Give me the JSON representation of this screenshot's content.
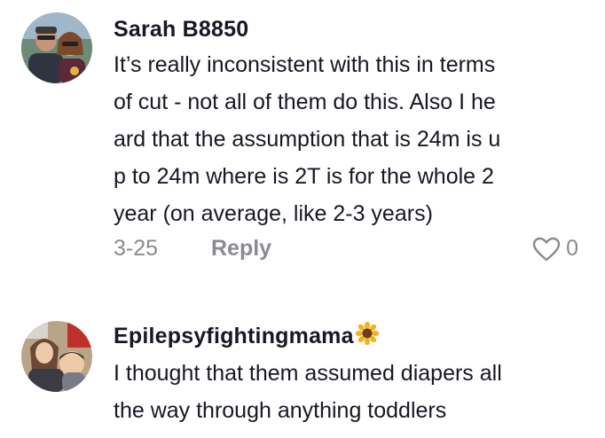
{
  "comments": [
    {
      "username": "Sarah B8850",
      "lines": [
        "It’s really inconsistent with this in terms",
        "of cut - not all of them do this. Also I he",
        "ard that the assumption that is 24m is u",
        "p to 24m where is 2T is for the whole 2",
        "year (on average, like 2-3 years)"
      ],
      "date": "3-25",
      "reply_label": "Reply",
      "like_count": "0"
    },
    {
      "username": "Epilepsyfightingmama",
      "username_emoji": "sunflower-icon",
      "lines": [
        "I thought that them assumed diapers all",
        "the way through anything toddlers"
      ]
    }
  ]
}
